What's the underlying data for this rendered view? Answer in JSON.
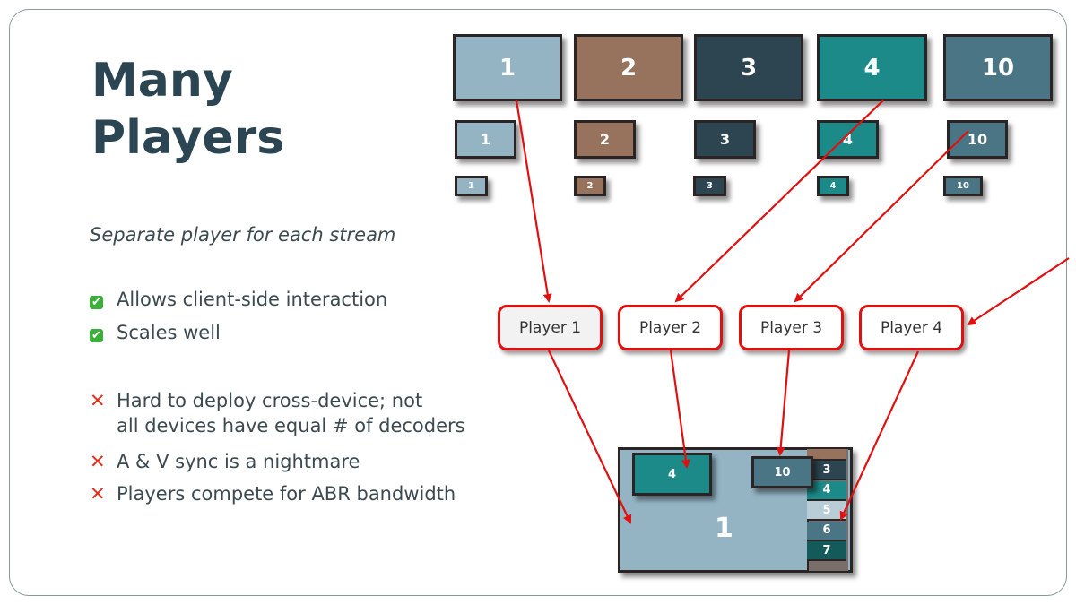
{
  "title_lines": [
    "Many",
    "Players"
  ],
  "subtitle": "Separate player for each stream",
  "pros": [
    "Allows client-side interaction",
    "Scales well"
  ],
  "cons": [
    "Hard to deploy cross-device; not",
    "all devices have equal # of decoders",
    "A & V sync is a nightmare",
    "Players compete for ABR bandwidth"
  ],
  "icons": {
    "pro": "check-mark-icon",
    "con": "cross-mark-icon"
  },
  "streams": [
    {
      "label": "1",
      "color": "#94b4c4"
    },
    {
      "label": "2",
      "color": "#97735d"
    },
    {
      "label": "3",
      "color": "#2c4550"
    },
    {
      "label": "4",
      "color": "#1c8a88"
    },
    {
      "label": "10",
      "color": "#4a7585"
    }
  ],
  "players": [
    "Player 1",
    "Player 2",
    "Player 3",
    "Player 4"
  ],
  "composite": {
    "main": "1",
    "pip1": "4",
    "pip2": "10",
    "sidebar": [
      "3",
      "4",
      "5",
      "6",
      "7"
    ],
    "sidebar_colors": [
      "#2c4550",
      "#1c8a88",
      "#b8cdd6",
      "#4a7585",
      "#145a5a"
    ]
  },
  "colors": {
    "arrow": "#e01010",
    "title": "#2b4552"
  }
}
